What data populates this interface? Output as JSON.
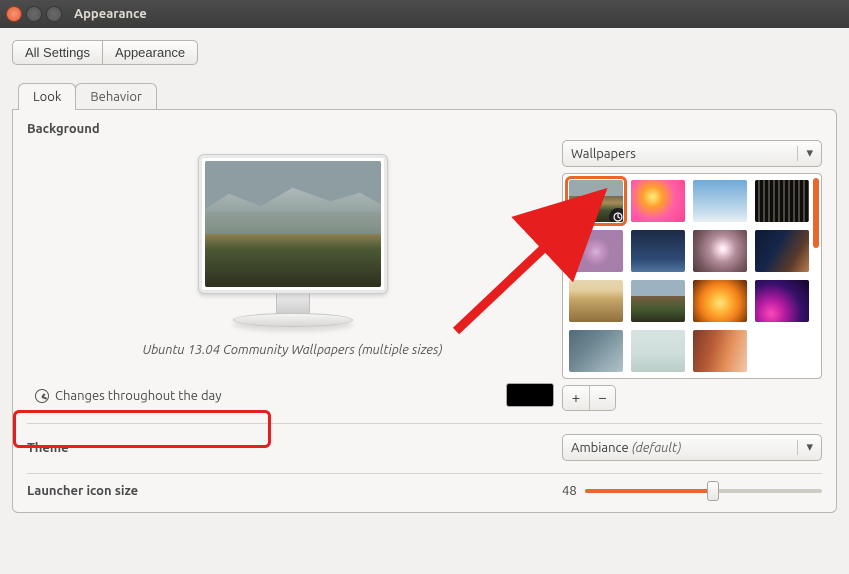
{
  "titlebar": {
    "title": "Appearance"
  },
  "breadcrumb": {
    "all_settings": "All Settings",
    "current": "Appearance"
  },
  "tabs": {
    "look": "Look",
    "behavior": "Behavior"
  },
  "background": {
    "label": "Background",
    "wall_name": "Ubuntu 13.04 Community Wallpapers  (multiple sizes)",
    "changes": "Changes throughout the day",
    "dropdown": "Wallpapers",
    "add": "+",
    "remove": "−"
  },
  "theme": {
    "label": "Theme",
    "value": "Ambiance",
    "default": " (default)"
  },
  "launcher": {
    "label": "Launcher icon size",
    "value": "48"
  }
}
